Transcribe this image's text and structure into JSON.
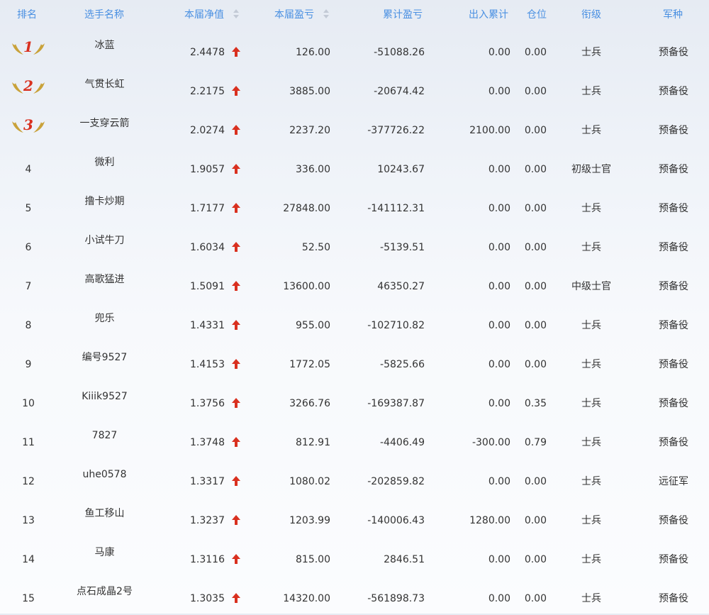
{
  "headers": {
    "rank": "排名",
    "name": "选手名称",
    "net_value": "本届净值",
    "profit": "本届盈亏",
    "cumulative": "累计盈亏",
    "inout": "出入累计",
    "position": "仓位",
    "grade": "衔级",
    "arm": "军种"
  },
  "colors": {
    "header_text": "#4a90e2",
    "up_arrow": "#d9301f",
    "medal_wing": "#c9a23a",
    "medal_number": "#d9301f"
  },
  "rows": [
    {
      "rank": "1",
      "medal": true,
      "name": "冰蓝",
      "nv": "2.4478",
      "pl": "126.00",
      "cum": "-51088.26",
      "io": "0.00",
      "pos": "0.00",
      "grade": "士兵",
      "arm": "预备役"
    },
    {
      "rank": "2",
      "medal": true,
      "name": "气贯长虹",
      "nv": "2.2175",
      "pl": "3885.00",
      "cum": "-20674.42",
      "io": "0.00",
      "pos": "0.00",
      "grade": "士兵",
      "arm": "预备役"
    },
    {
      "rank": "3",
      "medal": true,
      "name": "一支穿云箭",
      "nv": "2.0274",
      "pl": "2237.20",
      "cum": "-377726.22",
      "io": "2100.00",
      "pos": "0.00",
      "grade": "士兵",
      "arm": "预备役"
    },
    {
      "rank": "4",
      "name": "微利",
      "nv": "1.9057",
      "pl": "336.00",
      "cum": "10243.67",
      "io": "0.00",
      "pos": "0.00",
      "grade": "初级士官",
      "arm": "预备役"
    },
    {
      "rank": "5",
      "name": "撸卡炒期",
      "nv": "1.7177",
      "pl": "27848.00",
      "cum": "-141112.31",
      "io": "0.00",
      "pos": "0.00",
      "grade": "士兵",
      "arm": "预备役"
    },
    {
      "rank": "6",
      "name": "小试牛刀",
      "nv": "1.6034",
      "pl": "52.50",
      "cum": "-5139.51",
      "io": "0.00",
      "pos": "0.00",
      "grade": "士兵",
      "arm": "预备役"
    },
    {
      "rank": "7",
      "name": "高歌猛进",
      "nv": "1.5091",
      "pl": "13600.00",
      "cum": "46350.27",
      "io": "0.00",
      "pos": "0.00",
      "grade": "中级士官",
      "arm": "预备役"
    },
    {
      "rank": "8",
      "name": "兜乐",
      "nv": "1.4331",
      "pl": "955.00",
      "cum": "-102710.82",
      "io": "0.00",
      "pos": "0.00",
      "grade": "士兵",
      "arm": "预备役"
    },
    {
      "rank": "9",
      "name": "编号9527",
      "nv": "1.4153",
      "pl": "1772.05",
      "cum": "-5825.66",
      "io": "0.00",
      "pos": "0.00",
      "grade": "士兵",
      "arm": "预备役"
    },
    {
      "rank": "10",
      "name": "Kiiik9527",
      "nv": "1.3756",
      "pl": "3266.76",
      "cum": "-169387.87",
      "io": "0.00",
      "pos": "0.35",
      "grade": "士兵",
      "arm": "预备役"
    },
    {
      "rank": "11",
      "name": "7827",
      "nv": "1.3748",
      "pl": "812.91",
      "cum": "-4406.49",
      "io": "-300.00",
      "pos": "0.79",
      "grade": "士兵",
      "arm": "预备役"
    },
    {
      "rank": "12",
      "name": "uhe0578",
      "nv": "1.3317",
      "pl": "1080.02",
      "cum": "-202859.82",
      "io": "0.00",
      "pos": "0.00",
      "grade": "士兵",
      "arm": "远征军"
    },
    {
      "rank": "13",
      "name": "鱼工移山",
      "nv": "1.3237",
      "pl": "1203.99",
      "cum": "-140006.43",
      "io": "1280.00",
      "pos": "0.00",
      "grade": "士兵",
      "arm": "预备役"
    },
    {
      "rank": "14",
      "name": "马康",
      "nv": "1.3116",
      "pl": "815.00",
      "cum": "2846.51",
      "io": "0.00",
      "pos": "0.00",
      "grade": "士兵",
      "arm": "预备役"
    },
    {
      "rank": "15",
      "name": "点石成晶2号",
      "nv": "1.3035",
      "pl": "14320.00",
      "cum": "-561898.73",
      "io": "0.00",
      "pos": "0.00",
      "grade": "士兵",
      "arm": "预备役"
    }
  ]
}
